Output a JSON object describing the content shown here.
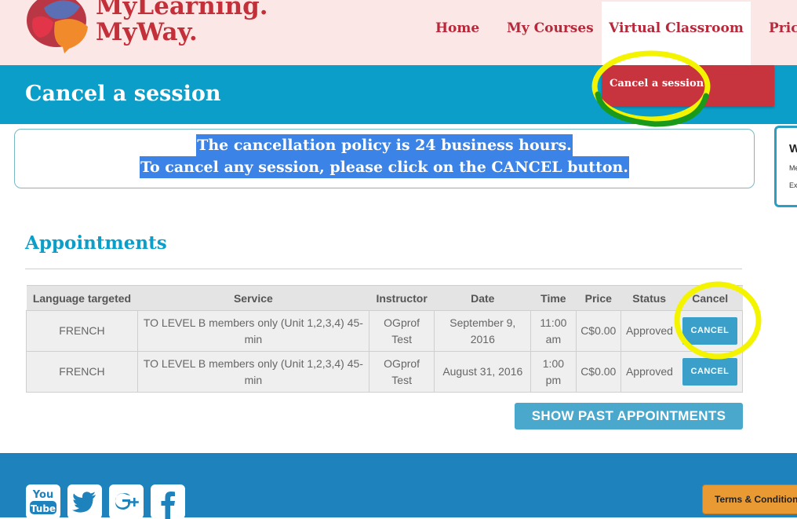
{
  "header": {
    "logo_line1": "MyLearning.",
    "logo_line2": "MyWay.",
    "nav": [
      "Home",
      "My Courses",
      "Virtual Classroom",
      "Prici"
    ],
    "dropdown_item": "Cancel a session"
  },
  "banner": {
    "title": "Cancel a session"
  },
  "policy": {
    "line1": "The cancellation policy is 24 business hours.",
    "line2": "To cancel any session, please click on the CANCEL button."
  },
  "side_panel": {
    "title": "W",
    "line1": "Me",
    "line2": "Ex"
  },
  "appointments": {
    "title": "Appointments",
    "columns": [
      "Language targeted",
      "Service",
      "Instructor",
      "Date",
      "Time",
      "Price",
      "Status",
      "Cancel"
    ],
    "rows": [
      {
        "language": "FRENCH",
        "service": "TO LEVEL B members only (Unit 1,2,3,4) 45-min",
        "instructor": "OGprof Test",
        "date": "September 9, 2016",
        "time": "11:00 am",
        "price": "C$0.00",
        "status": "Approved",
        "cancel_label": "CANCEL"
      },
      {
        "language": "FRENCH",
        "service": "TO LEVEL B members only (Unit 1,2,3,4) 45-min",
        "instructor": "OGprof Test",
        "date": "August 31, 2016",
        "time": "1:00 pm",
        "price": "C$0.00",
        "status": "Approved",
        "cancel_label": "CANCEL"
      }
    ],
    "show_past_label": "SHOW PAST APPOINTMENTS"
  },
  "footer": {
    "social_icons": [
      "youtube-icon",
      "twitter-icon",
      "google-plus-icon",
      "facebook-icon"
    ],
    "youtube_top": "You",
    "youtube_bottom": "Tube",
    "terms_label": "Terms & Condition"
  },
  "colors": {
    "brand_red": "#c3303a",
    "banner_blue": "#0b9ec9",
    "button_blue": "#3a9fc9",
    "footer_blue": "#1e82bd",
    "terms_orange": "#e99a32",
    "highlight_yellow": "#f4f400",
    "highlight_green": "#1a9a1a"
  }
}
